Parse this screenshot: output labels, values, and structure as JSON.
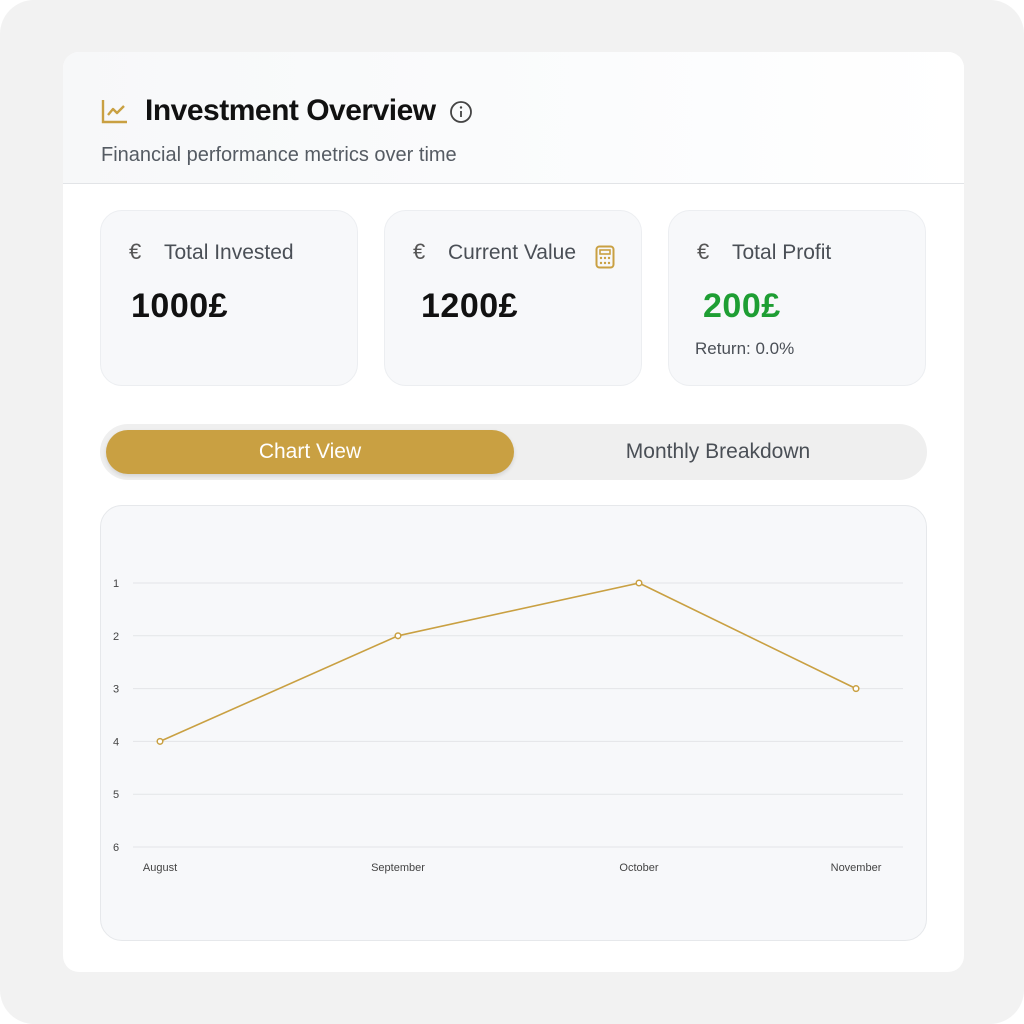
{
  "header": {
    "title": "Investment Overview",
    "subtitle": "Financial performance metrics over time",
    "icon": "line-chart-icon",
    "info_icon": "info-icon"
  },
  "stats": [
    {
      "icon": "euro-icon",
      "symbol": "€",
      "label": "Total Invested",
      "value": "1000£"
    },
    {
      "icon": "euro-icon",
      "symbol": "€",
      "label": "Current Value",
      "value": "1200£",
      "extra_icon": "calculator-icon"
    },
    {
      "icon": "euro-icon",
      "symbol": "€",
      "label": "Total Profit",
      "value": "200£",
      "sub": "Return: 0.0%"
    }
  ],
  "tabs": [
    {
      "label": "Chart View",
      "active": true
    },
    {
      "label": "Monthly Breakdown",
      "active": false
    }
  ],
  "colors": {
    "accent": "#c9a042",
    "profit": "#1e9e33",
    "grid": "#e3e5e8"
  },
  "chart_data": {
    "type": "line",
    "categories": [
      "August",
      "September",
      "October",
      "November"
    ],
    "series": [
      {
        "values": [
          4,
          2,
          1,
          3
        ]
      }
    ],
    "yticks": [
      1,
      2,
      3,
      4,
      5,
      6
    ],
    "ylim": [
      1,
      6
    ],
    "y_inverted": true,
    "grid": true,
    "color": "#c9a042"
  }
}
